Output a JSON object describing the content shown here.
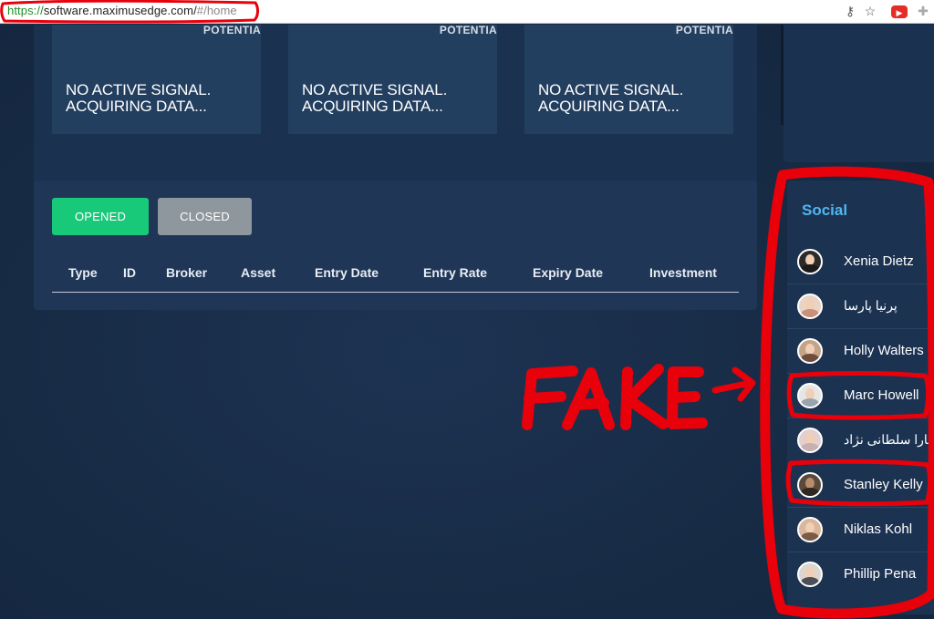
{
  "browser": {
    "url_scheme": "https://",
    "url_host": "software.maximusedge.com/",
    "url_hash": "#/home",
    "icons": [
      "key-icon",
      "star-icon",
      "youtube-icon",
      "extension-icon"
    ]
  },
  "signals": [
    {
      "label": "POTENTIA",
      "message": "NO ACTIVE SIGNAL.\nACQUIRING DATA..."
    },
    {
      "label": "POTENTIA",
      "message": "NO ACTIVE SIGNAL.\nACQUIRING DATA..."
    },
    {
      "label": "POTENTIA",
      "message": "NO ACTIVE SIGNAL.\nACQUIRING DATA..."
    }
  ],
  "trades": {
    "opened_label": "OPENED",
    "closed_label": "CLOSED",
    "columns": [
      "Type",
      "ID",
      "Broker",
      "Asset",
      "Entry Date",
      "Entry Rate",
      "Expiry Date",
      "Investment"
    ]
  },
  "social": {
    "title": "Social",
    "users": [
      {
        "name": "Xenia Dietz"
      },
      {
        "name": "پرنیا پارسا"
      },
      {
        "name": "Holly Walters"
      },
      {
        "name": "Marc Howell"
      },
      {
        "name": "سارا سلطانی نژاد"
      },
      {
        "name": "Stanley Kelly"
      },
      {
        "name": "Niklas Kohl"
      },
      {
        "name": "Phillip Pena"
      }
    ]
  },
  "annotation": {
    "text": "FAKE",
    "color": "#e8000b"
  },
  "colors": {
    "opened_button": "#19c97a",
    "closed_button": "#8e969e",
    "social_title": "#4fb6ee",
    "background": "#172b45"
  }
}
